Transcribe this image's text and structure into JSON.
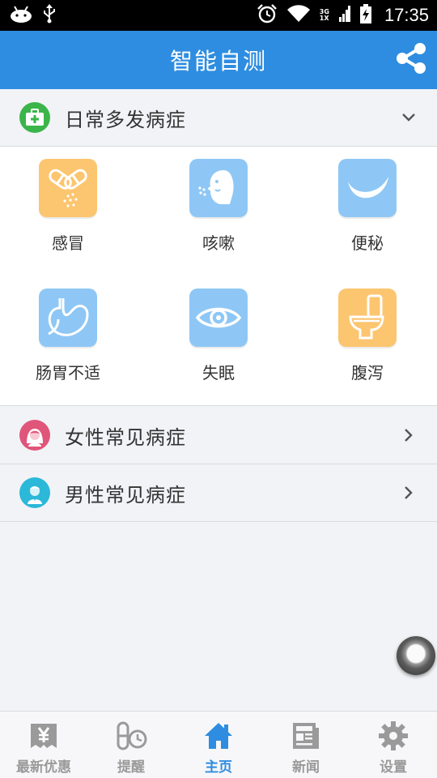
{
  "status_bar": {
    "time": "17:35",
    "network_top": "3G",
    "network_bottom": "1X"
  },
  "header": {
    "title": "智能自测",
    "share_icon": "share-icon"
  },
  "sections": {
    "common": {
      "title": "日常多发病症",
      "icon": "medical-kit-icon",
      "color": "#3bb54a"
    },
    "female": {
      "title": "女性常见病症",
      "icon": "female-avatar-icon",
      "color": "#e0557a"
    },
    "male": {
      "title": "男性常见病症",
      "icon": "male-avatar-icon",
      "color": "#2cb8d8"
    }
  },
  "symptoms": [
    {
      "label": "感冒",
      "icon": "pills-icon",
      "color": "#fcc56f"
    },
    {
      "label": "咳嗽",
      "icon": "cough-face-icon",
      "color": "#8ec7f5"
    },
    {
      "label": "便秘",
      "icon": "banana-icon",
      "color": "#8ec7f5"
    },
    {
      "label": "肠胃不适",
      "icon": "stomach-icon",
      "color": "#8ec7f5"
    },
    {
      "label": "失眠",
      "icon": "eye-icon",
      "color": "#8ec7f5"
    },
    {
      "label": "腹泻",
      "icon": "toilet-icon",
      "color": "#fcc56f"
    }
  ],
  "bottom_nav": [
    {
      "label": "最新优惠",
      "icon": "yen-coupon-icon",
      "active": false
    },
    {
      "label": "提醒",
      "icon": "pill-clock-icon",
      "active": false
    },
    {
      "label": "主页",
      "icon": "home-icon",
      "active": true
    },
    {
      "label": "新闻",
      "icon": "newspaper-icon",
      "active": false
    },
    {
      "label": "设置",
      "icon": "gear-icon",
      "active": false
    }
  ],
  "colors": {
    "header": "#2e8de0",
    "active_nav": "#2e8de0",
    "inactive_nav": "#9a9a9a"
  }
}
